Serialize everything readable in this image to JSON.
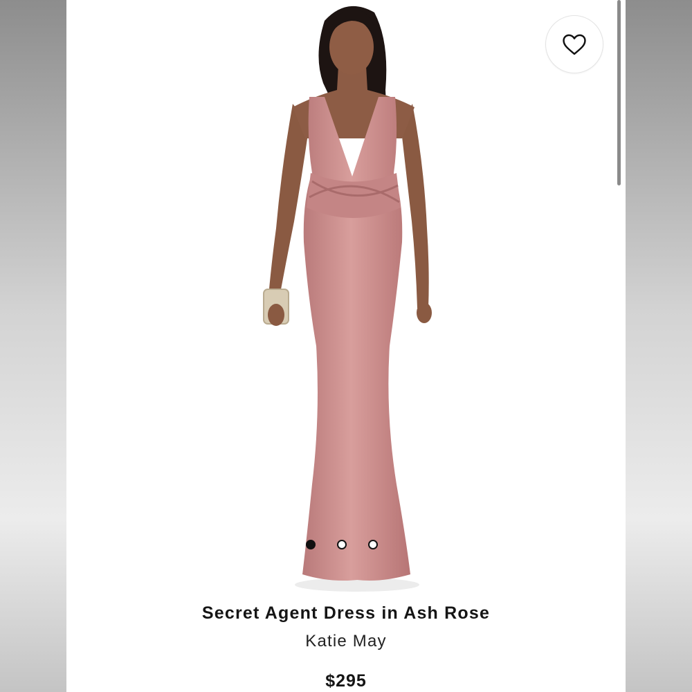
{
  "product": {
    "title": "Secret Agent Dress in Ash Rose",
    "brand": "Katie May",
    "price": "$295",
    "image_alt": "Model wearing pink floor-length gown with plunging neckline holding a clutch"
  },
  "actions": {
    "favorite_icon": "heart-outline-icon"
  },
  "carousel": {
    "total_images": 3,
    "active_index": 0
  },
  "colors": {
    "dress": "#c98b8b",
    "text": "#151515",
    "accent_dot": "#111111"
  }
}
